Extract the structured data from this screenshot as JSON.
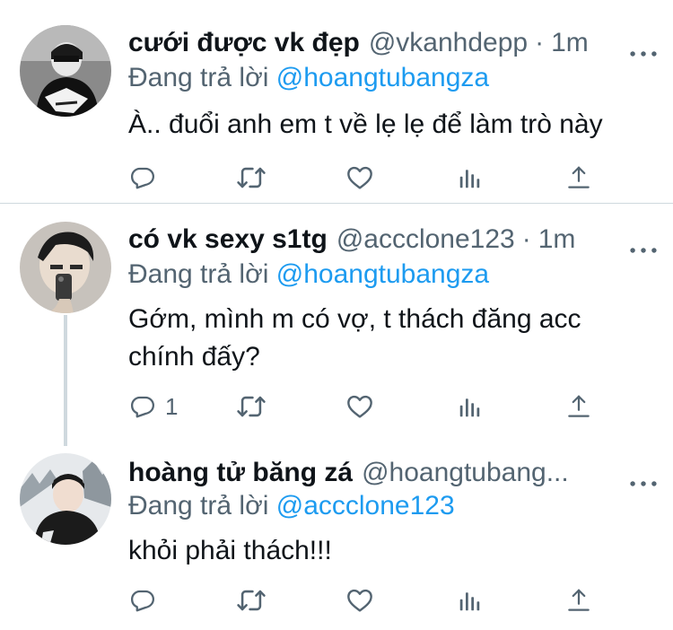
{
  "tweets": [
    {
      "name": "cưới được vk đẹp",
      "handle": "@vkanhdepp",
      "separator": "·",
      "time": "1m",
      "reply_prefix": "Đang trả lời",
      "reply_to": "@hoangtubangza",
      "text": "À.. đuổi anh em t về lẹ lẹ để làm trò này",
      "reply_count": ""
    },
    {
      "name": "có vk sexy s1tg",
      "handle": "@accclone123",
      "separator": "·",
      "time": "1m",
      "reply_prefix": "Đang trả lời",
      "reply_to": "@hoangtubangza",
      "text_line1": "Gớm, mình m có vợ, t thách đăng acc",
      "text_line2": "chính đấy?",
      "reply_count": "1"
    },
    {
      "name": "hoàng tử băng zá",
      "handle": "@hoangtubang...",
      "reply_prefix": "Đang trả lời",
      "reply_to": "@accclone123",
      "text": "khỏi phải thách!!!",
      "reply_count": ""
    }
  ],
  "icons": [
    "reply-icon",
    "retweet-icon",
    "like-icon",
    "analytics-icon",
    "share-icon",
    "more-icon"
  ],
  "colors": {
    "text": "#0f1419",
    "secondary": "#536471",
    "mention": "#1d9bf0",
    "divider": "#cfd9de"
  }
}
